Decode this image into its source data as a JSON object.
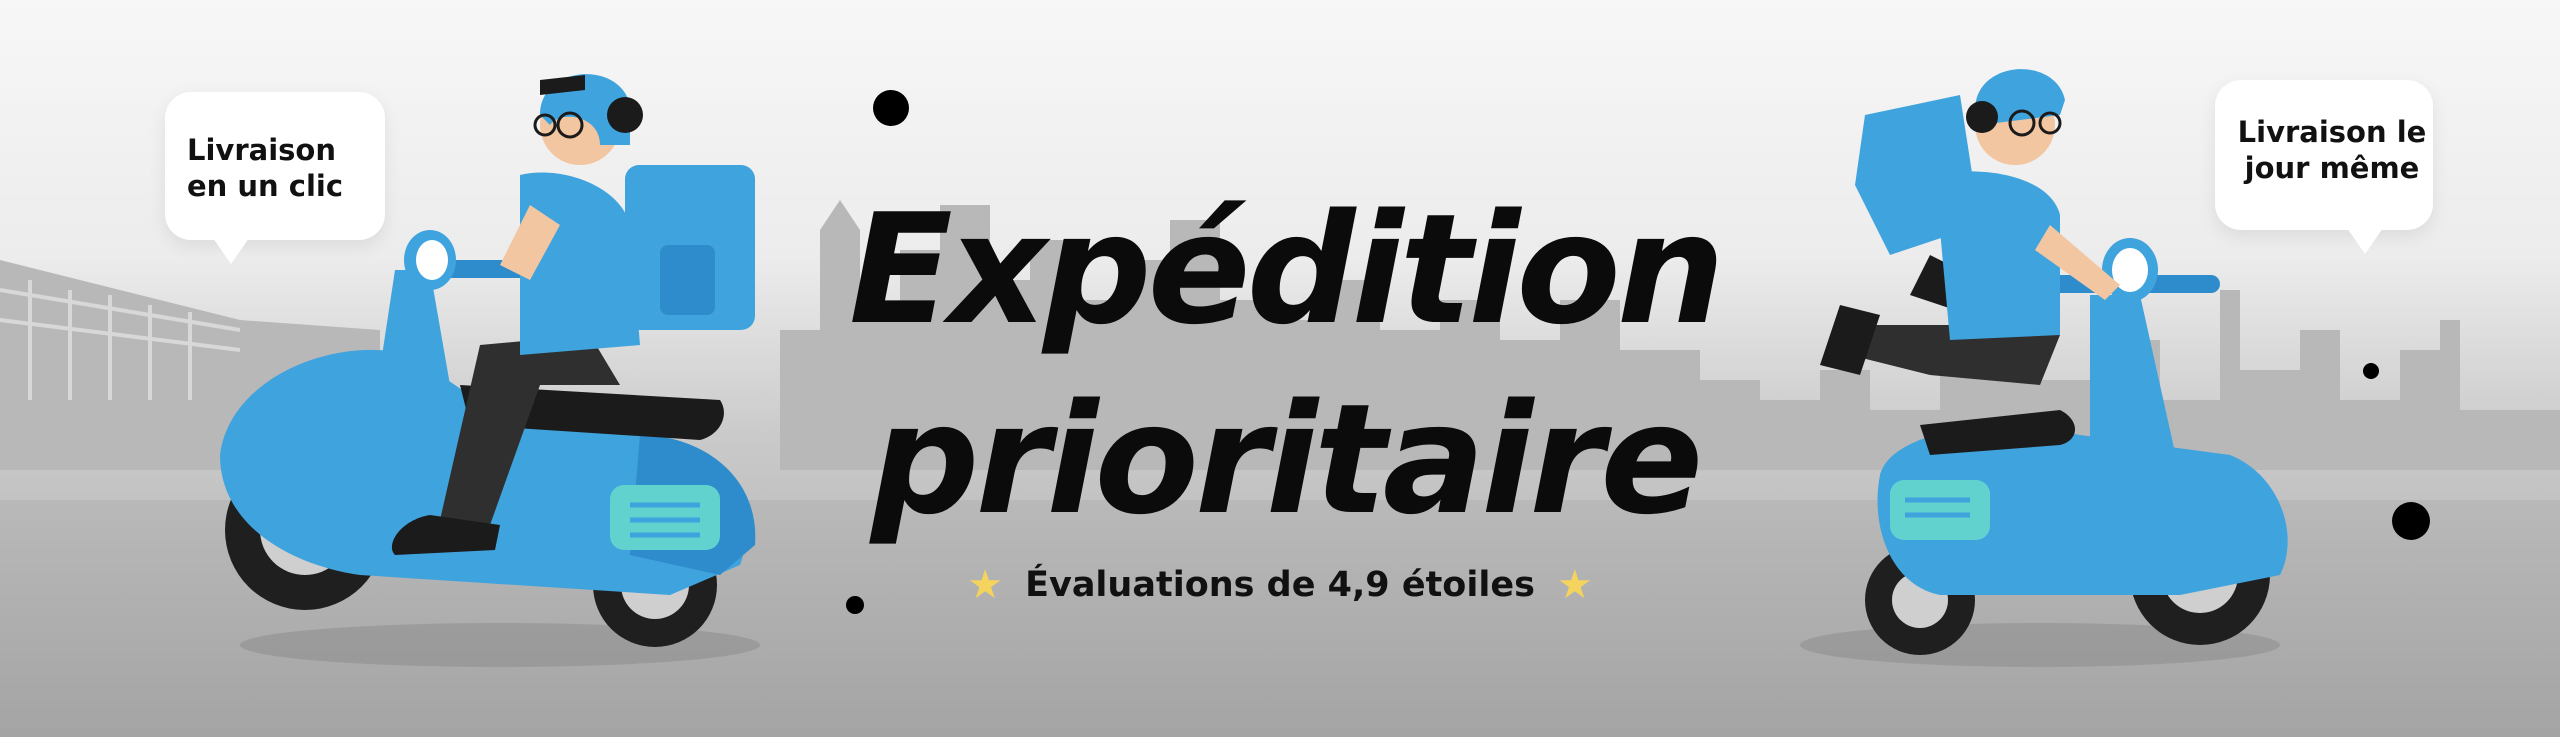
{
  "banner": {
    "title_line1": "Expédition",
    "title_line2": "prioritaire",
    "rating_text": "Évaluations de 4,9 étoiles",
    "star_icon": "star-icon",
    "star_color": "#f4d35e",
    "bubble_left_text": "Livraison en un clic",
    "bubble_right_text": "Livraison le jour même",
    "accent_blue": "#3fa3dd",
    "text_color": "#0b0b0b"
  }
}
